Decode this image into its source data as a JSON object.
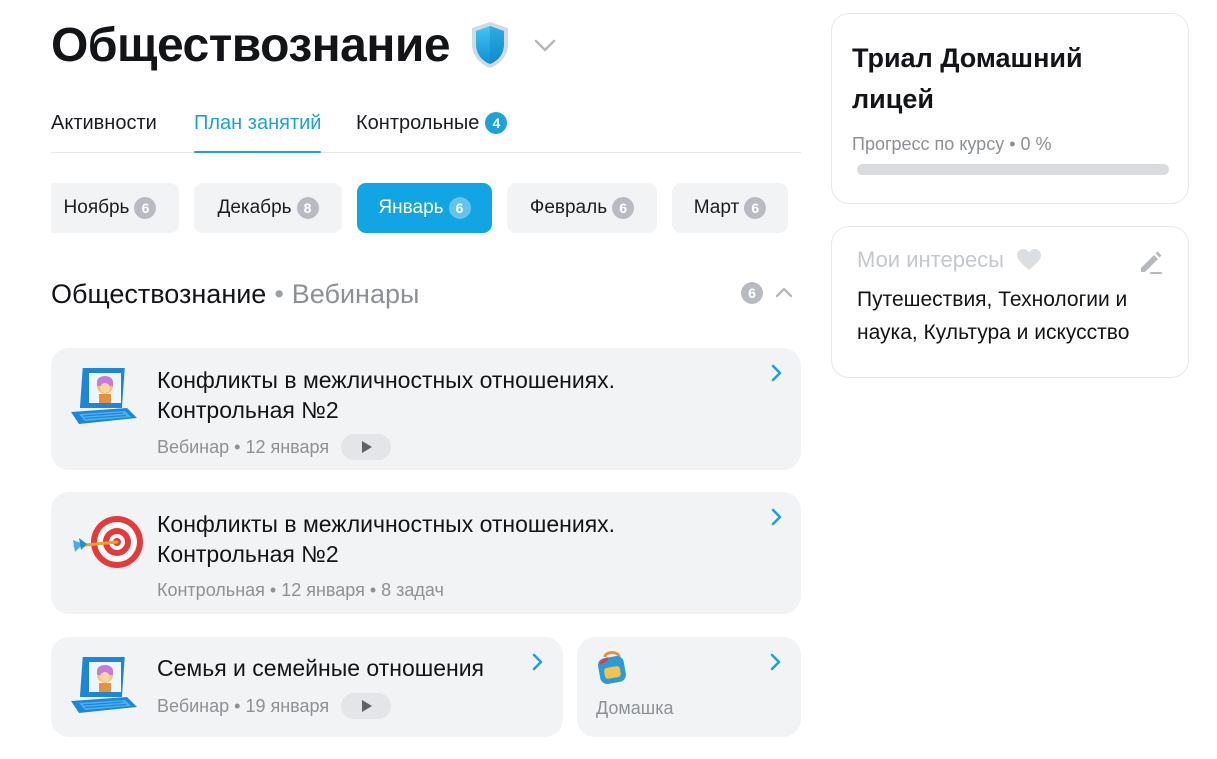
{
  "header": {
    "title": "Обществознание",
    "shield_icon": "shield-icon",
    "dropdown_icon": "chevron-down-icon"
  },
  "tabs": [
    {
      "label": "Активности",
      "active": false
    },
    {
      "label": "План занятий",
      "active": true
    },
    {
      "label": "Контрольные",
      "active": false,
      "badge": "4"
    }
  ],
  "months": [
    {
      "label": "Ноябрь",
      "count": "6",
      "active": false
    },
    {
      "label": "Декабрь",
      "count": "8",
      "active": false
    },
    {
      "label": "Январь",
      "count": "6",
      "active": true
    },
    {
      "label": "Февраль",
      "count": "6",
      "active": false
    },
    {
      "label": "Март",
      "count": "6",
      "active": false
    }
  ],
  "section": {
    "title": "Обществознание",
    "separator": "•",
    "subtitle": "Вебинары",
    "count": "6"
  },
  "cards": [
    {
      "title_line1": "Конфликты в межличностных отношениях.",
      "title_line2": "Контрольная №2",
      "meta": "Вебинар • 12 января",
      "icon": "laptop-icon",
      "has_play": true
    },
    {
      "title_line1": "Конфликты в межличностных отношениях.",
      "title_line2": "Контрольная №2",
      "meta": "Контрольная • 12 января • 8 задач",
      "icon": "target-icon",
      "has_play": false
    },
    {
      "title_line1": "Семья и семейные отношения",
      "meta": "Вебинар • 19 января",
      "icon": "laptop-icon",
      "has_play": true
    },
    {
      "label": "Домашка",
      "icon": "backpack-icon"
    }
  ],
  "trial": {
    "title": "Триал Домашний лицей",
    "progress_label": "Прогресс по курсу • 0 %",
    "progress": 0
  },
  "interests": {
    "title": "Мои интересы",
    "text": "Путешествия, Технологии и наука, Культура и искусство"
  },
  "colors": {
    "accent": "#12a5e3",
    "tab_active": "#1aa3d8",
    "card_bg": "#f2f3f5",
    "muted_text": "#8c9196",
    "badge_gray": "#b8bcc2"
  }
}
